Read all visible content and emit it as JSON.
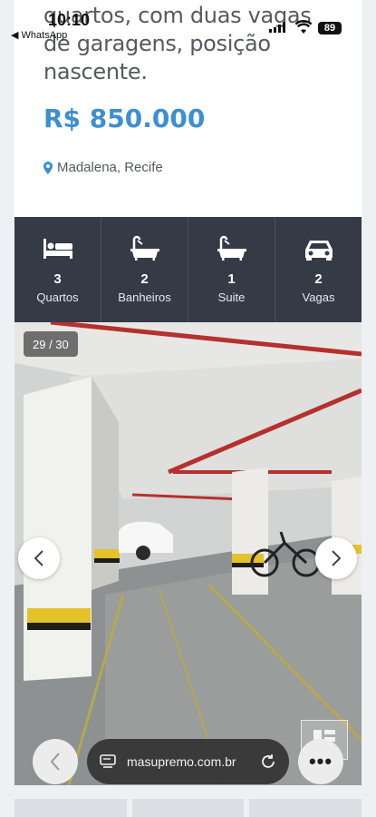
{
  "status_bar": {
    "time": "10:10",
    "back_app": "◀ WhatsApp",
    "battery": "89"
  },
  "listing": {
    "description": "quartos, com duas vagas de garagens, posição nascente.",
    "price": "R$ 850.000",
    "location": "Madalena, Recife"
  },
  "features": [
    {
      "icon": "bed-icon",
      "count": "3",
      "label": "Quartos"
    },
    {
      "icon": "bathtub-icon",
      "count": "2",
      "label": "Banheiros"
    },
    {
      "icon": "bathtub-icon",
      "count": "1",
      "label": "Suite"
    },
    {
      "icon": "car-icon",
      "count": "2",
      "label": "Vagas"
    }
  ],
  "gallery": {
    "counter": "29 / 30"
  },
  "browser": {
    "url": "masupremo.com.br",
    "more": "•••"
  }
}
